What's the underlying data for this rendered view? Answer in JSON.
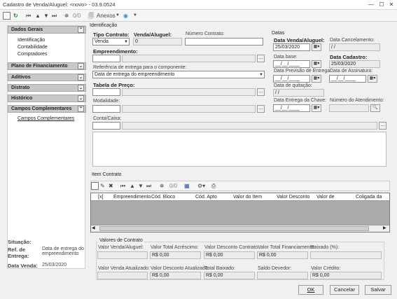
{
  "window": {
    "title": "Cadastro de Venda/Aluguel: <novo> - 03.9.0524"
  },
  "toolbar": {
    "counter": "0/0",
    "anexos_label": "Anexos"
  },
  "sidebar": {
    "dados_gerais": "Dados Gerais",
    "dg_items": [
      "Identificação",
      "Contabilidade",
      "Compradores"
    ],
    "plano": "Plano de Financiamento",
    "aditivos": "Aditivos",
    "distrato": "Distrato",
    "historico": "Histórico",
    "campos": "Campos Complementares",
    "campos_items": [
      "Campos Complementares"
    ]
  },
  "identificacao": {
    "section": "Identificação",
    "tipo_contrato_label": "Tipo Contrato:",
    "tipo_contrato_value": "Venda",
    "venda_label": "Venda/Aluguel:",
    "venda_value": "0",
    "numero_contrato_label": "Número Contrato:",
    "empreendimento_label": "Empreendimento:",
    "referencia_label": "Referência de entrega para o componente:",
    "referencia_value": "Data de entrega do empreendimento",
    "tabela_label": "Tabela de Preço:",
    "modalidade_label": "Modalidade:",
    "conta_label": "Conta/Caixa:"
  },
  "datas": {
    "section": "Datas",
    "data_venda_label": "Data Venda/Aluguel:",
    "data_venda_value": "25/03/2020",
    "data_cancel_label": "Data Cancelamento:",
    "data_cancel_value": " / /",
    "data_base_label": "Data base:",
    "data_base_value": "__/__/____",
    "data_cadastro_label": "Data Cadastro:",
    "data_cadastro_value": "25/03/2020",
    "previsao_label": "Data Previsão de Entrega:",
    "previsao_value": "__/__/____",
    "assinatura_label": "Data de Assinatura:",
    "assinatura_value": "__/__/____",
    "quitacao_label": "Data de quitação:",
    "quitacao_value": " / /",
    "chave_label": "Data Entrega da Chave:",
    "chave_value": "__/__/____",
    "atendimento_label": "Número do Atendimento:"
  },
  "item_contrato": {
    "section": "Item Contrato",
    "counter": "0/0",
    "columns": [
      "[x]",
      "Empreendimento",
      "Cód. Bloco",
      "Cód. Apto",
      "Valor do Item",
      "Valor Desconto",
      "Valor de",
      "Coligada da"
    ]
  },
  "bottom_left": {
    "situacao_label": "Situação:",
    "ref_label": "Ref. de Entrega:",
    "ref_value": "Data de entrega do empreendimento",
    "data_venda_label": "Data Venda:",
    "data_venda_value": "25/03/2020"
  },
  "valores": {
    "section": "Valores de Contrato",
    "row1_labels": [
      "Valor Venda/Aluguel:",
      "Valor Total Acréscimo:",
      "Valor Desconto Contrato:",
      "Valor Total Financiamento:",
      "Baixado (%):"
    ],
    "row1_values": [
      "",
      "R$ 0,00",
      "R$ 0,00",
      "R$ 0,00",
      ""
    ],
    "row2_labels": [
      "Valor Venda Atualizado:",
      "Valor Desconto Atualizado:",
      "Total Baixado:",
      "Saldo Devedor:",
      "Valor Crédito:"
    ],
    "row2_values": [
      "",
      "R$ 0,00",
      "R$ 0,00",
      "",
      "R$ 0,00"
    ]
  },
  "buttons": {
    "ok": "OK",
    "cancel": "Cancelar",
    "save": "Salvar"
  }
}
